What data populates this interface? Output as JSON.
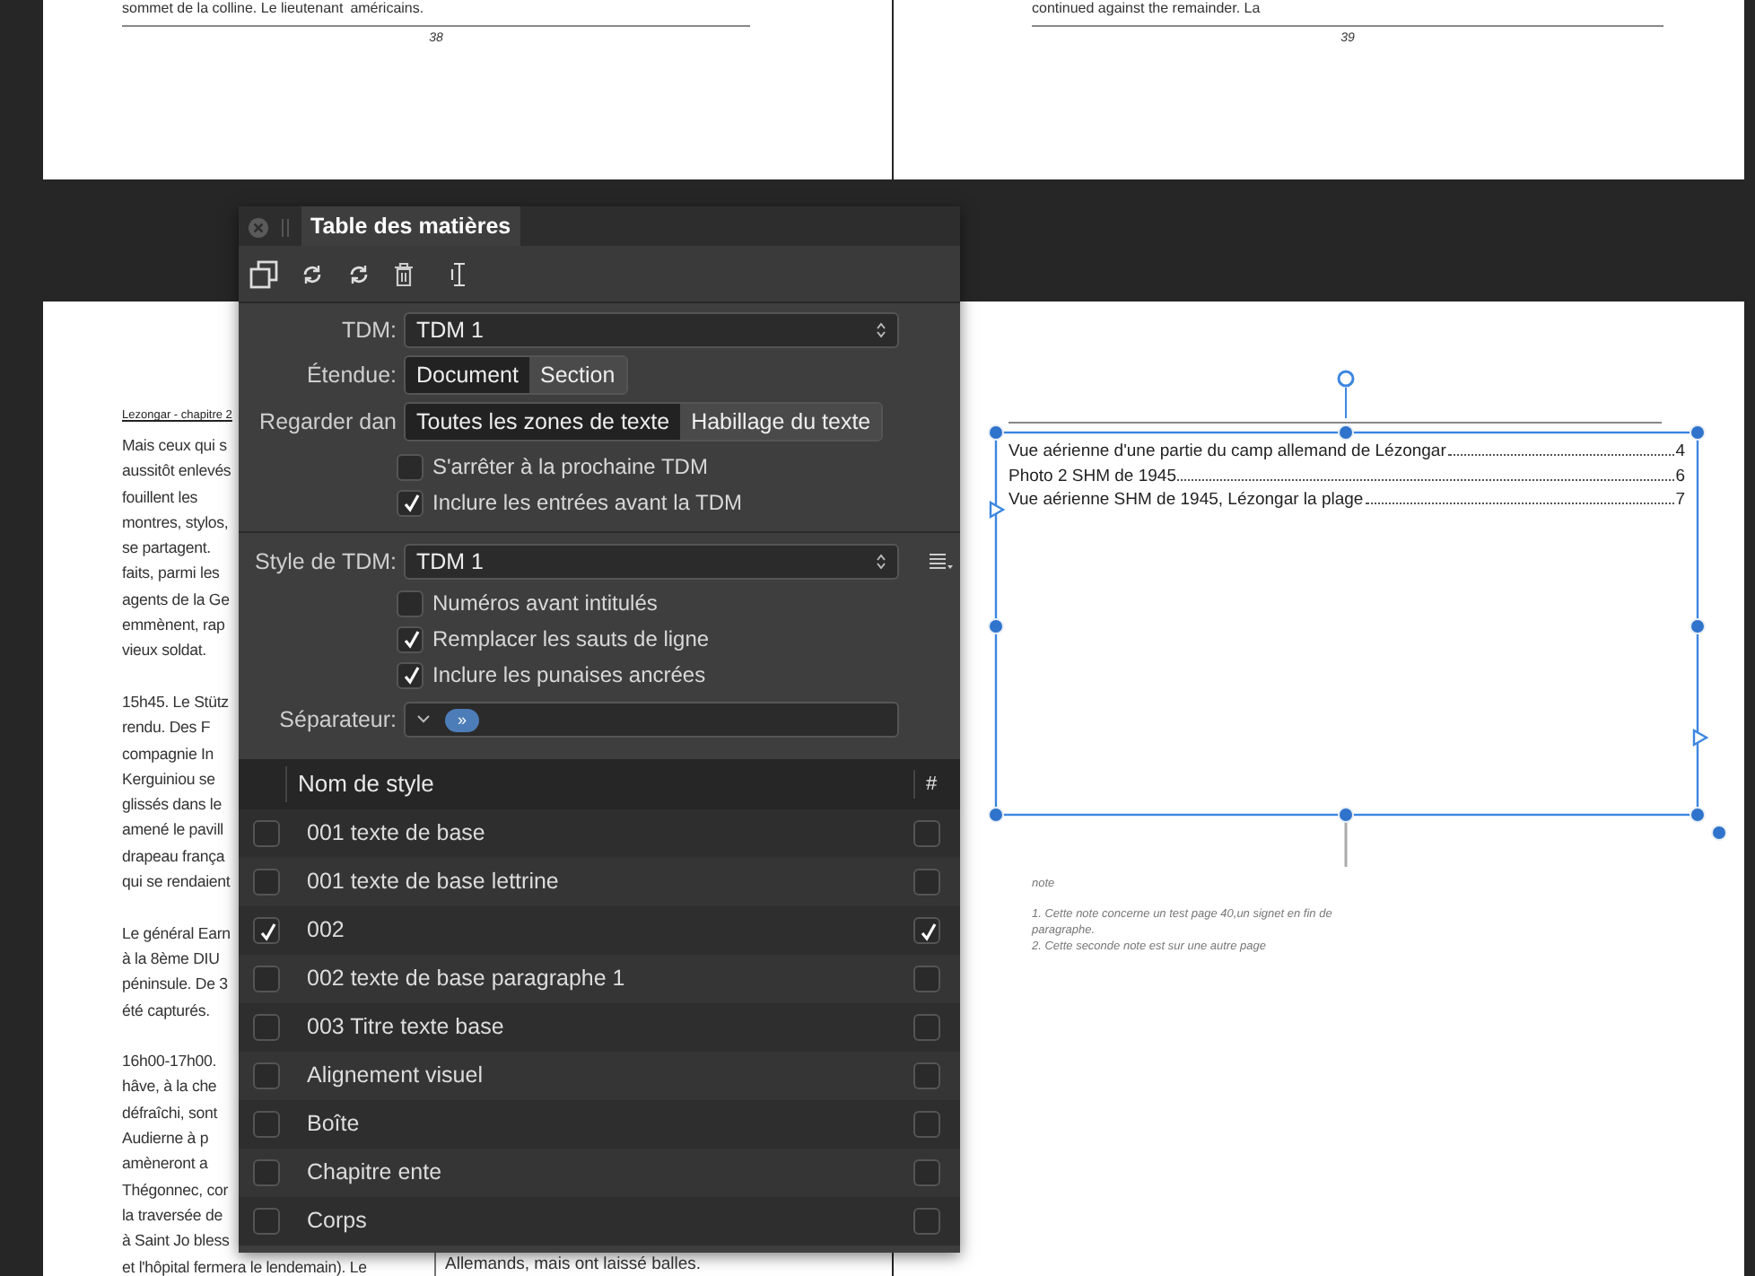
{
  "top_pages": [
    {
      "text": [
        "sommet de la colline. Le lieutenant",
        "américains."
      ],
      "page_number": "38"
    },
    {
      "text": [
        "continued against the remainder. La"
      ],
      "page_number": "39"
    }
  ],
  "left_page": {
    "running_head": "Lezongar - chapitre 2",
    "column_1_paragraphs": [
      [
        "Mais ceux qui s",
        "aussitôt enlevés",
        "fouillent les",
        "montres, stylos,",
        "se partagent.",
        "faits, parmi les",
        "agents de la Ge",
        "emmènent, rap",
        "vieux soldat."
      ],
      [
        "15h45. Le Stütz",
        "rendu. Des F",
        "compagnie In",
        "Kerguiniou se",
        "glissés dans le",
        "amené le pavill",
        "drapeau frança",
        "qui se rendaient"
      ],
      [
        "Le général Earn",
        "à la 8ème DIU",
        "péninsule. De 3",
        "été capturés."
      ],
      [
        "16h00-17h00.",
        "hâve, à la che",
        "défraîchi, sont",
        "Audierne à p",
        "amèneront a",
        "Thégonnec, cor",
        "la traversée de",
        "à Saint Jo bless",
        "et l'hôpital fermera le lendemain). Le"
      ]
    ],
    "column_2_lines": [
      "Allemands, mais ont laissé balles."
    ]
  },
  "right_page": {
    "toc_entries": [
      {
        "title": "Vue aérienne d'une partie du camp allemand de Lézongar",
        "page": "4"
      },
      {
        "title": "Photo 2 SHM de 1945",
        "page": "6"
      },
      {
        "title": "Vue aérienne SHM de 1945, Lézongar la plage",
        "page": "7"
      }
    ],
    "notes": {
      "heading": "note",
      "items": [
        "1. Cette note concerne un test page 40,un signet en fin de paragraphe.",
        "2. Cette seconde note est sur une autre page"
      ]
    }
  },
  "panel": {
    "title": "Table des matières",
    "tdm": {
      "label": "TDM:",
      "value": "TDM 1"
    },
    "scope": {
      "label": "Étendue:",
      "options": [
        {
          "label": "Document",
          "selected": true
        },
        {
          "label": "Section",
          "selected": false
        }
      ]
    },
    "look_in": {
      "label": "Regarder dan",
      "options": [
        {
          "label": "Toutes les zones de texte",
          "selected": true
        },
        {
          "label": "Habillage du texte",
          "selected": false
        }
      ]
    },
    "options_1": [
      {
        "label": "S'arrêter à la prochaine TDM",
        "checked": false
      },
      {
        "label": "Inclure les entrées avant la TDM",
        "checked": true
      }
    ],
    "style": {
      "label": "Style de TDM:",
      "value": "TDM 1"
    },
    "options_2": [
      {
        "label": "Numéros avant intitulés",
        "checked": false
      },
      {
        "label": "Remplacer les sauts de ligne",
        "checked": true
      },
      {
        "label": "Inclure les punaises ancrées",
        "checked": true
      }
    ],
    "separator": {
      "label": "Séparateur:",
      "token": "»"
    },
    "table": {
      "columns": [
        "Nom de style",
        "#"
      ],
      "rows": [
        {
          "name": "001 texte de base",
          "included": false,
          "numbered": false
        },
        {
          "name": "001 texte de base lettrine",
          "included": false,
          "numbered": false
        },
        {
          "name": "002",
          "included": true,
          "numbered": true
        },
        {
          "name": "002 texte de base paragraphe 1",
          "included": false,
          "numbered": false
        },
        {
          "name": "003 Titre texte base",
          "included": false,
          "numbered": false
        },
        {
          "name": "Alignement visuel",
          "included": false,
          "numbered": false
        },
        {
          "name": "Boîte",
          "included": false,
          "numbered": false
        },
        {
          "name": "Chapitre ente",
          "included": false,
          "numbered": false
        },
        {
          "name": "Corps",
          "included": false,
          "numbered": false
        }
      ]
    }
  }
}
